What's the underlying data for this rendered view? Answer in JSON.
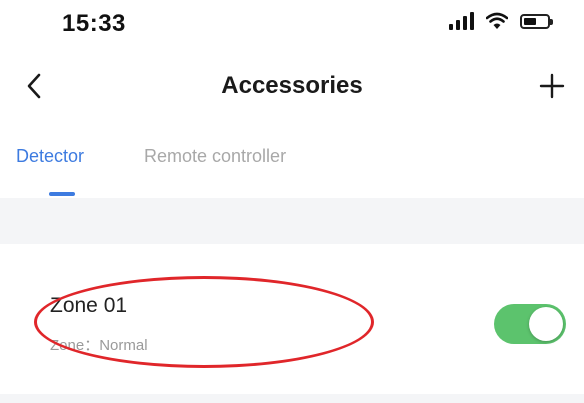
{
  "status_bar": {
    "time": "15:33",
    "icons": [
      "signal-icon",
      "wifi-icon",
      "battery-icon"
    ]
  },
  "nav": {
    "title": "Accessories",
    "back_icon": "chevron-left-icon",
    "add_icon": "plus-icon"
  },
  "tabs": [
    {
      "label": "Detector",
      "active": true
    },
    {
      "label": "Remote controller",
      "active": false
    }
  ],
  "accessories": [
    {
      "name": "Zone 01",
      "zone_status": "Zone：Normal",
      "enabled": true
    }
  ],
  "colors": {
    "accent": "#3d7be0",
    "toggle_on": "#5cc36d",
    "highlight": "#e0262a"
  }
}
